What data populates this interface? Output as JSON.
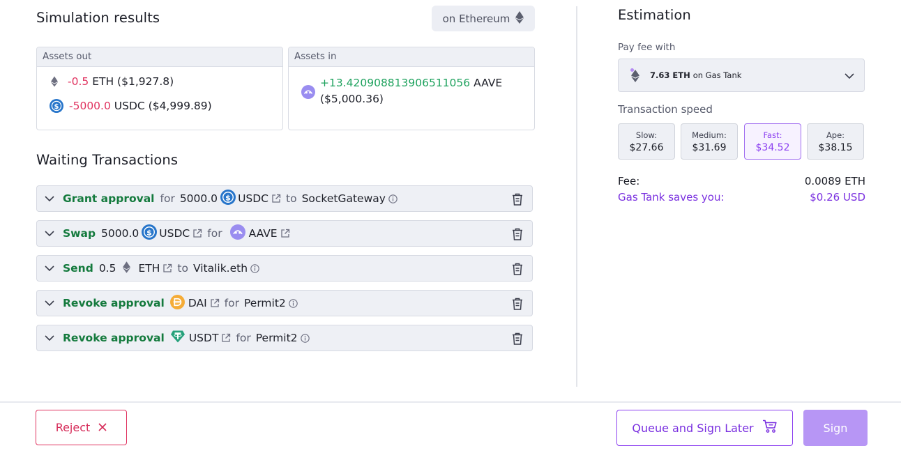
{
  "simulation": {
    "title": "Simulation results",
    "network_label": "on Ethereum",
    "assets_out_label": "Assets out",
    "assets_in_label": "Assets in",
    "assets_out": [
      {
        "amount": "-0.5",
        "symbol": "ETH",
        "usd": "($1,927.8)",
        "icon": "eth-icon"
      },
      {
        "amount": "-5000.0",
        "symbol": "USDC",
        "usd": "($4,999.89)",
        "icon": "usdc-icon"
      }
    ],
    "assets_in": [
      {
        "amount": "+13.420908813906511056",
        "symbol": "AAVE",
        "usd": "($5,000.36)",
        "icon": "aave-icon"
      }
    ]
  },
  "waiting": {
    "title": "Waiting Transactions",
    "transactions": [
      {
        "action": "Grant approval",
        "w1": "for",
        "amount": "5000.0",
        "token": "USDC",
        "w2": "to",
        "target": "SocketGateway"
      },
      {
        "action": "Swap",
        "amount": "5000.0",
        "token": "USDC",
        "w1": "for",
        "token2": "AAVE"
      },
      {
        "action": "Send",
        "amount": "0.5",
        "token": "ETH",
        "w1": "to",
        "target": "Vitalik.eth"
      },
      {
        "action": "Revoke approval",
        "token": "DAI",
        "w1": "for",
        "target": "Permit2"
      },
      {
        "action": "Revoke approval",
        "token": "USDT",
        "w1": "for",
        "target": "Permit2"
      }
    ]
  },
  "estimation": {
    "title": "Estimation",
    "pay_fee_label": "Pay fee with",
    "pay_amount": "7.63 ETH",
    "pay_source": "on Gas Tank",
    "speed_label": "Transaction speed",
    "speeds": [
      {
        "label": "Slow:",
        "value": "$27.66"
      },
      {
        "label": "Medium:",
        "value": "$31.69"
      },
      {
        "label": "Fast:",
        "value": "$34.52",
        "selected": true
      },
      {
        "label": "Ape:",
        "value": "$38.15"
      }
    ],
    "fee_label": "Fee:",
    "fee_value": "0.0089 ETH",
    "savings_label": "Gas Tank saves you:",
    "savings_value": "$0.26 USD"
  },
  "actions": {
    "reject": "Reject",
    "queue": "Queue and Sign Later",
    "sign": "Sign"
  },
  "colors": {
    "accent": "#8b3ff0",
    "negative": "#e0325f",
    "positive": "#20a35f",
    "action_green": "#147a3d"
  }
}
